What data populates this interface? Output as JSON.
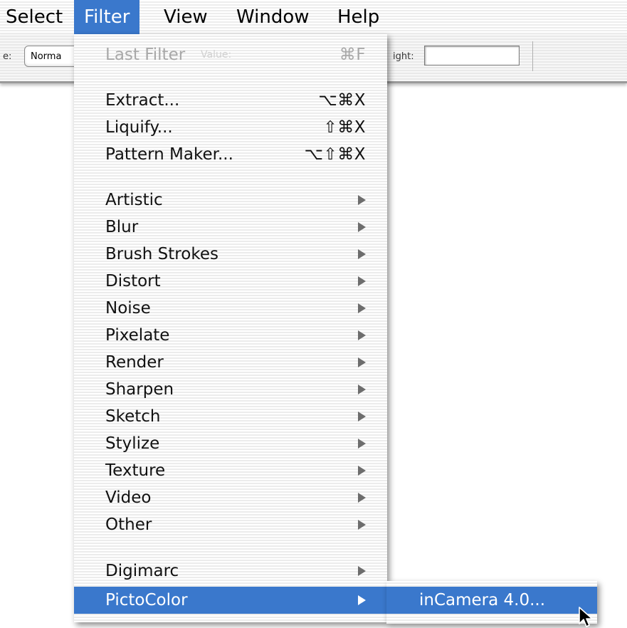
{
  "menubar": {
    "items": [
      {
        "label": "Select"
      },
      {
        "label": "Filter"
      },
      {
        "label": "View"
      },
      {
        "label": "Window"
      },
      {
        "label": "Help"
      }
    ]
  },
  "toolbar": {
    "style_label": "e:",
    "style_value": "Norma",
    "height_label": "ight:",
    "ghost_value_label": "Value:"
  },
  "filter_menu": {
    "last_filter": {
      "label": "Last Filter",
      "shortcut": "⌘F"
    },
    "group1": [
      {
        "label": "Extract...",
        "shortcut": "⌥⌘X"
      },
      {
        "label": "Liquify...",
        "shortcut": "⇧⌘X"
      },
      {
        "label": "Pattern Maker...",
        "shortcut": "⌥⇧⌘X"
      }
    ],
    "group2": [
      {
        "label": "Artistic"
      },
      {
        "label": "Blur"
      },
      {
        "label": "Brush Strokes"
      },
      {
        "label": "Distort"
      },
      {
        "label": "Noise"
      },
      {
        "label": "Pixelate"
      },
      {
        "label": "Render"
      },
      {
        "label": "Sharpen"
      },
      {
        "label": "Sketch"
      },
      {
        "label": "Stylize"
      },
      {
        "label": "Texture"
      },
      {
        "label": "Video"
      },
      {
        "label": "Other"
      }
    ],
    "group3": [
      {
        "label": "Digimarc"
      },
      {
        "label": "PictoColor"
      }
    ]
  },
  "submenu": {
    "items": [
      {
        "label": "inCamera 4.0..."
      }
    ]
  },
  "colors": {
    "highlight": "#3a78cc",
    "disabled_text": "#a8a8a8",
    "arrow": "#6d6d6d"
  },
  "icons": {
    "submenu_arrow": "right-triangle",
    "cursor": "mouse-pointer-arrow"
  }
}
